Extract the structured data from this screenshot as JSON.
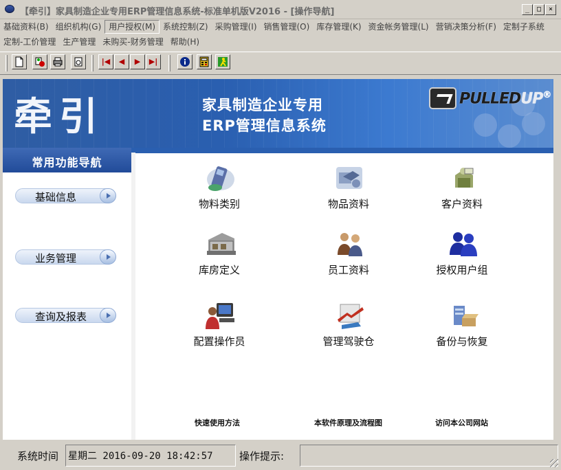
{
  "window": {
    "title": "【牵引】家具制造企业专用ERP管理信息系统-标准单机版V2016 - [操作导航]",
    "controls": {
      "minimize": "_",
      "maximize": "□",
      "close": "×"
    }
  },
  "menu": {
    "row1": [
      "基础资料(B)",
      "组织机构(G)",
      "用户授权(M)",
      "系统控制(Z)",
      "采购管理(I)",
      "销售管理(O)",
      "库存管理(K)",
      "资金帐务管理(L)",
      "营销决策分析(F)",
      "定制子系统"
    ],
    "row2": [
      "定制-工价管理",
      "生产管理",
      "未购买-财务管理",
      "帮助(H)"
    ],
    "active_index": 2
  },
  "toolbar": {
    "buttons": [
      "new-doc-icon",
      "edit-icon",
      "print-icon",
      "export-icon",
      "first-record-icon",
      "prev-record-icon",
      "next-record-icon",
      "last-record-icon",
      "info-icon",
      "calculator-icon",
      "exit-icon"
    ]
  },
  "banner": {
    "logo": "牵引",
    "title_line1": "家具制造企业专用",
    "title_line2": "ERP管理信息系统",
    "brand_a": "PULLED",
    "brand_b": "UP",
    "brand_mark": "®"
  },
  "sidebar": {
    "header": "常用功能导航",
    "items": [
      {
        "label": "基础信息"
      },
      {
        "label": "业务管理"
      },
      {
        "label": "查询及报表"
      }
    ]
  },
  "main": {
    "tiles": [
      {
        "label": "物料类别",
        "icon": "material-category-icon"
      },
      {
        "label": "物品资料",
        "icon": "item-data-icon"
      },
      {
        "label": "客户资料",
        "icon": "customer-data-icon"
      },
      {
        "label": "库房定义",
        "icon": "warehouse-icon"
      },
      {
        "label": "员工资料",
        "icon": "employee-icon"
      },
      {
        "label": "授权用户组",
        "icon": "user-group-icon"
      },
      {
        "label": "配置操作员",
        "icon": "operator-icon"
      },
      {
        "label": "管理驾驶仓",
        "icon": "cockpit-icon"
      },
      {
        "label": "备份与恢复",
        "icon": "backup-icon"
      }
    ],
    "links": [
      "快速使用方法",
      "本软件原理及流程图",
      "访问本公司网站"
    ]
  },
  "status": {
    "time_label": "系统时间",
    "time_value": "星期二 2016-09-20 18:42:57",
    "hint_label": "操作提示:",
    "hint_value": ""
  }
}
